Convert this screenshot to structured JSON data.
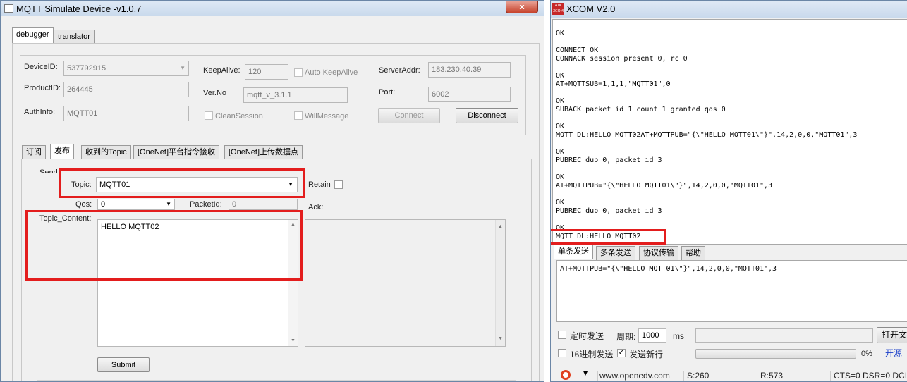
{
  "left_window": {
    "title": "MQTT Simulate Device  -v1.0.7",
    "close": "x",
    "tabs": [
      "debugger",
      "translator"
    ],
    "device": {
      "device_id_label": "DeviceID:",
      "device_id": "537792915",
      "product_id_label": "ProductID:",
      "product_id": "264445",
      "auth_label": "AuthInfo:",
      "auth": "MQTT01",
      "keepalive_label": "KeepAlive:",
      "keepalive": "120",
      "auto_keepalive": "Auto KeepAlive",
      "ver_label": "Ver.No",
      "ver": "mqtt_v_3.1.1",
      "clean_session": "CleanSession",
      "will_message": "WillMessage",
      "server_label": "ServerAddr:",
      "server": "183.230.40.39",
      "port_label": "Port:",
      "port": "6002",
      "connect": "Connect",
      "disconnect": "Disconnect"
    },
    "sub_tabs": [
      "订阅",
      "发布",
      "收到的Topic",
      "[OneNet]平台指令接收",
      "[OneNet]上传数据点"
    ],
    "publish": {
      "send_label": "Send",
      "topic_label": "Topic:",
      "topic": "MQTT01",
      "retain": "Retain",
      "qos_label": "Qos:",
      "qos": "0",
      "packetid_label": "PacketId:",
      "packetid": "0",
      "ack_label": "Ack:",
      "content_label": "Topic_Content:",
      "content": "HELLO MQTT02",
      "submit": "Submit"
    }
  },
  "right_window": {
    "title": "XCOM V2.0",
    "logo": "ATK XCOM",
    "log_lines": [
      "OK",
      "",
      "CONNECT OK",
      "CONNACK session present 0, rc 0",
      "",
      "OK",
      "AT+MQTTSUB=1,1,1,\"MQTT01\",0",
      "",
      "OK",
      "SUBACK packet id 1 count 1 granted qos 0",
      "",
      "OK",
      "MQTT DL:HELLO MQTT02AT+MQTTPUB=\"{\\\"HELLO MQTT01\\\"}\",14,2,0,0,\"MQTT01\",3",
      "",
      "OK",
      "PUBREC dup 0, packet id 3",
      "",
      "OK",
      "AT+MQTTPUB=\"{\\\"HELLO MQTT01\\\"}\",14,2,0,0,\"MQTT01\",3",
      "",
      "OK",
      "PUBREC dup 0, packet id 3",
      "",
      "OK",
      "MQTT DL:HELLO MQTT02"
    ],
    "tabs": [
      "单条发送",
      "多条发送",
      "协议传输",
      "帮助"
    ],
    "send_text": "AT+MQTTPUB=\"{\\\"HELLO MQTT01\\\"}\",14,2,0,0,\"MQTT01\",3",
    "timed_send": "定时发送",
    "period_label": "周期:",
    "period": "1000",
    "period_unit": "ms",
    "open_file": "打开文",
    "hex_send": "16进制发送",
    "newline": "发送新行",
    "progress": "0%",
    "open_source": "开源",
    "status": {
      "url": "www.openedv.com",
      "s": "S:260",
      "r": "R:573",
      "lines": "CTS=0 DSR=0 DCI"
    }
  },
  "colors": {
    "highlight": "#e31d1d",
    "titlebar": "#c9d9ec"
  }
}
